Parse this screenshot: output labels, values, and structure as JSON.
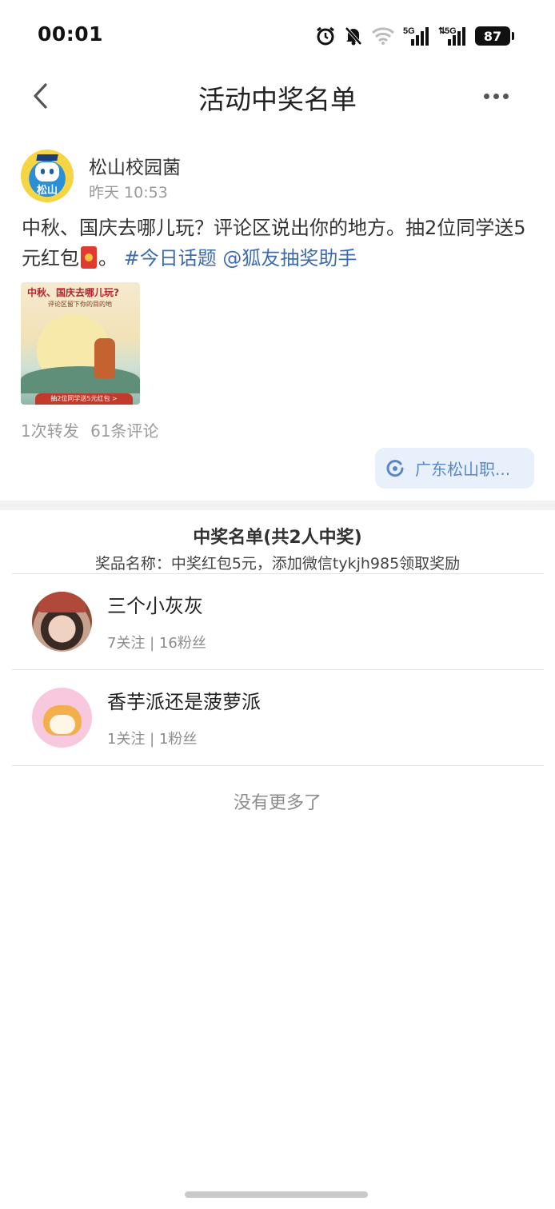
{
  "status_bar": {
    "time": "00:01",
    "network_1": "5G",
    "network_2": "5G",
    "battery": "87",
    "icons": [
      "alarm-icon",
      "mute-bell-icon",
      "wifi-icon",
      "signal-5g-icon",
      "signal-5g-icon",
      "battery-icon"
    ]
  },
  "nav": {
    "title": "活动中奖名单",
    "back_icon": "chevron-left-icon",
    "more_icon": "more-dots-icon"
  },
  "post": {
    "author": "松山校园菌",
    "avatar_text": "松山",
    "time": "昨天 10:53",
    "text_before": "中秋、国庆去哪儿玩？评论区说出你的地方。抽2位同学送5元红包",
    "text_after": "。",
    "topic": "#今日话题",
    "mention": "@狐友抽奖助手",
    "image": {
      "title": "中秋、国庆去哪儿玩?",
      "subtitle": "评论区留下你的目的地",
      "banner": "抽2位同学送5元红包 >"
    },
    "reposts": "1次转发",
    "comments": "61条评论",
    "chip_label": "广东松山职..."
  },
  "winners": {
    "title": "中奖名单(共2人中奖)",
    "prize": "奖品名称：中奖红包5元，添加微信tykjh985领取奖励",
    "list": [
      {
        "name": "三个小灰灰",
        "meta": "7关注 | 16粉丝"
      },
      {
        "name": "香芋派还是菠萝派",
        "meta": "1关注 | 1粉丝"
      }
    ],
    "no_more": "没有更多了"
  },
  "colors": {
    "link": "#3e6bb0",
    "chip_bg": "#e8f0fb",
    "chip_text": "#5a86c8",
    "muted": "#9a9a9a"
  }
}
